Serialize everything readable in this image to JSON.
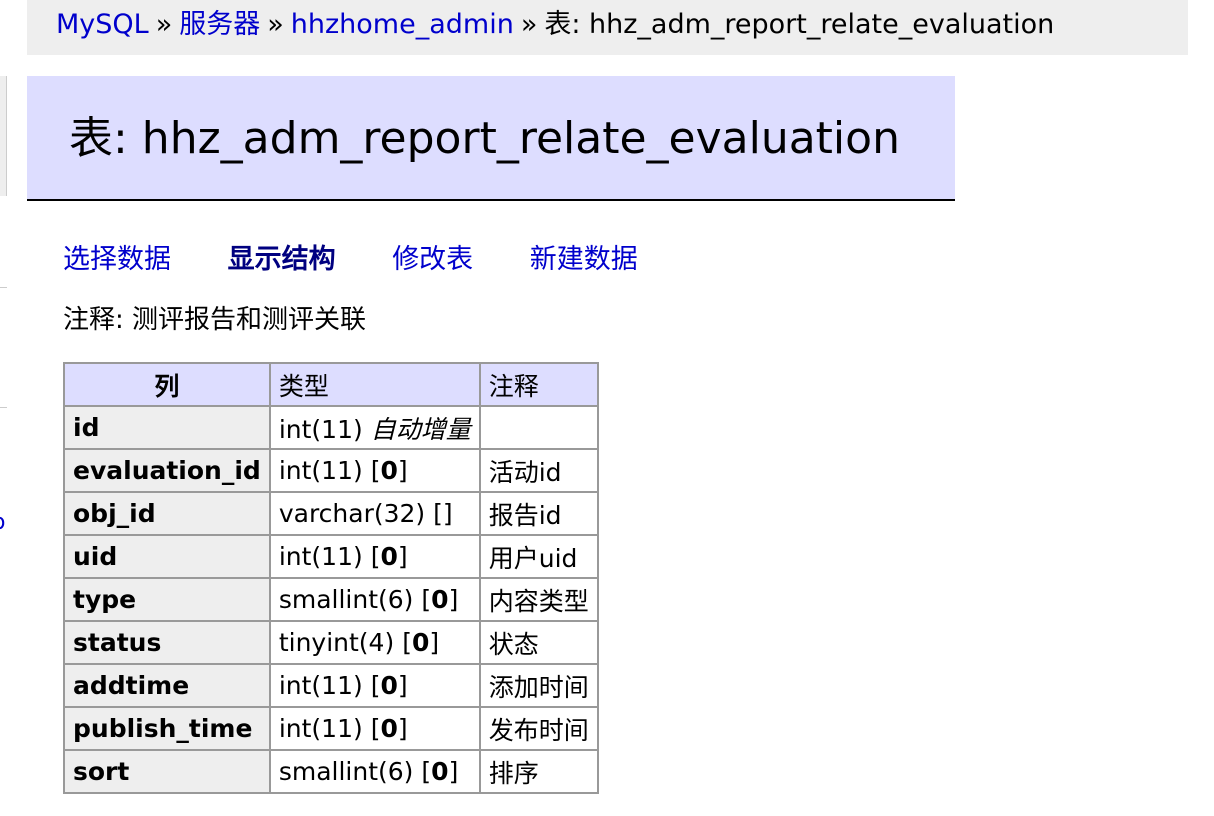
{
  "breadcrumb": {
    "items": [
      "MySQL",
      "服务器",
      "hhzhome_admin"
    ],
    "separator": "»",
    "current": "表: hhz_adm_report_relate_evaluation"
  },
  "sidebar": {
    "fragment": "o"
  },
  "heading": "表: hhz_adm_report_relate_evaluation",
  "actions": [
    {
      "label": "选择数据",
      "active": false
    },
    {
      "label": "显示结构",
      "active": true
    },
    {
      "label": "修改表",
      "active": false
    },
    {
      "label": "新建数据",
      "active": false
    }
  ],
  "table_comment": "注释: 测评报告和测评关联",
  "structure": {
    "headers": [
      "列",
      "类型",
      "注释"
    ],
    "rows": [
      {
        "name": "id",
        "type": "int(11)",
        "default": "",
        "extra": "自动增量",
        "comment": ""
      },
      {
        "name": "evaluation_id",
        "type": "int(11)",
        "default": "0",
        "extra": "",
        "comment": "活动id"
      },
      {
        "name": "obj_id",
        "type": "varchar(32)",
        "default": "",
        "extra": "",
        "comment": "报告id"
      },
      {
        "name": "uid",
        "type": "int(11)",
        "default": "0",
        "extra": "",
        "comment": "用户uid"
      },
      {
        "name": "type",
        "type": "smallint(6)",
        "default": "0",
        "extra": "",
        "comment": "内容类型"
      },
      {
        "name": "status",
        "type": "tinyint(4)",
        "default": "0",
        "extra": "",
        "comment": "状态"
      },
      {
        "name": "addtime",
        "type": "int(11)",
        "default": "0",
        "extra": "",
        "comment": "添加时间"
      },
      {
        "name": "publish_time",
        "type": "int(11)",
        "default": "0",
        "extra": "",
        "comment": "发布时间"
      },
      {
        "name": "sort",
        "type": "smallint(6)",
        "default": "0",
        "extra": "",
        "comment": "排序"
      }
    ]
  },
  "colors": {
    "link": "#0000cc",
    "heading_bg": "#ddddff",
    "breadcrumb_bg": "#eeeeee",
    "row_header_bg": "#eeeeee",
    "border": "#999999"
  }
}
